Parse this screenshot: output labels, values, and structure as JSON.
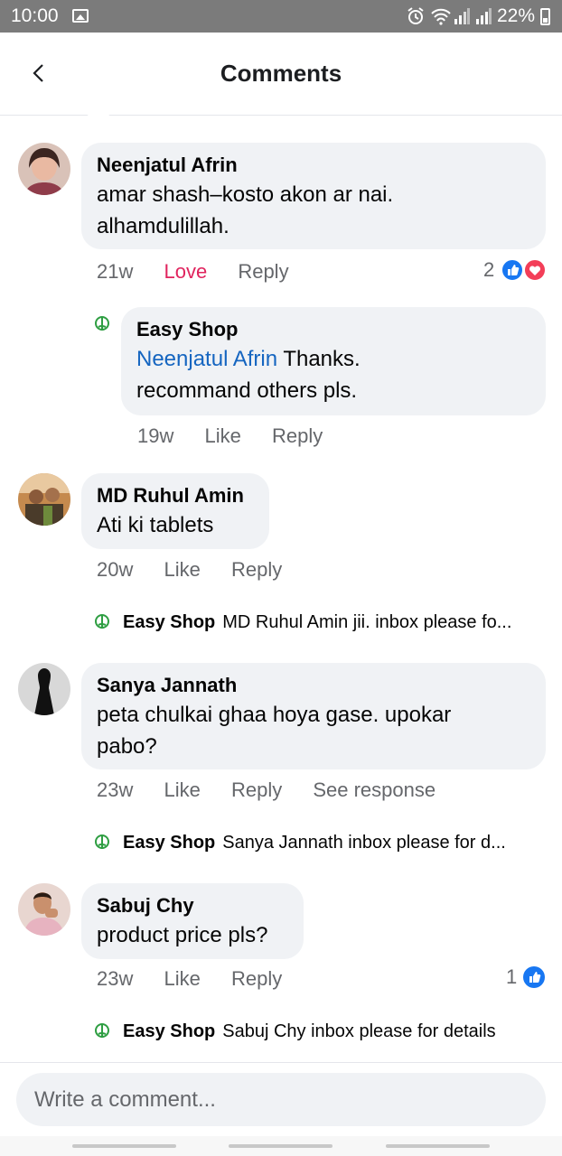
{
  "status_bar": {
    "time": "10:00",
    "battery": "22%"
  },
  "header": {
    "title": "Comments"
  },
  "comments": [
    {
      "author": "Neenjatul Afrin",
      "text_lines": [
        "amar shash–kosto akon ar nai.",
        "alhamdulillah."
      ],
      "time": "21w",
      "love": "Love",
      "reply": "Reply",
      "reaction_count": "2",
      "replies": [
        {
          "author": "Easy Shop",
          "mention": "Neenjatul Afrin",
          "text_after_mention": " Thanks.",
          "text_line2": "recommand others pls.",
          "time": "19w",
          "like": "Like",
          "reply": "Reply"
        }
      ]
    },
    {
      "author": "MD Ruhul Amin",
      "text_lines": [
        "Ati ki tablets"
      ],
      "time": "20w",
      "like": "Like",
      "reply": "Reply",
      "reply_preview": {
        "author": "Easy Shop",
        "text": "MD Ruhul Amin jii. inbox please fo..."
      }
    },
    {
      "author": "Sanya Jannath",
      "text_lines": [
        "peta chulkai ghaa hoya gase. upokar",
        "pabo?"
      ],
      "time": "23w",
      "like": "Like",
      "reply": "Reply",
      "see_response": "See response",
      "reply_preview": {
        "author": "Easy Shop",
        "text": "Sanya Jannath inbox please for d..."
      }
    },
    {
      "author": "Sabuj Chy",
      "text_lines": [
        "product price pls?"
      ],
      "time": "23w",
      "like": "Like",
      "reply": "Reply",
      "reaction_count": "1",
      "reply_preview": {
        "author": "Easy Shop",
        "text": "Sabuj Chy inbox please for details"
      }
    }
  ],
  "composer": {
    "placeholder": "Write a comment..."
  },
  "colors": {
    "accent_blue": "#1877f2",
    "love_red": "#e0245e",
    "bubble_bg": "#f0f2f5",
    "status_bar_bg": "#7b7b7b"
  }
}
